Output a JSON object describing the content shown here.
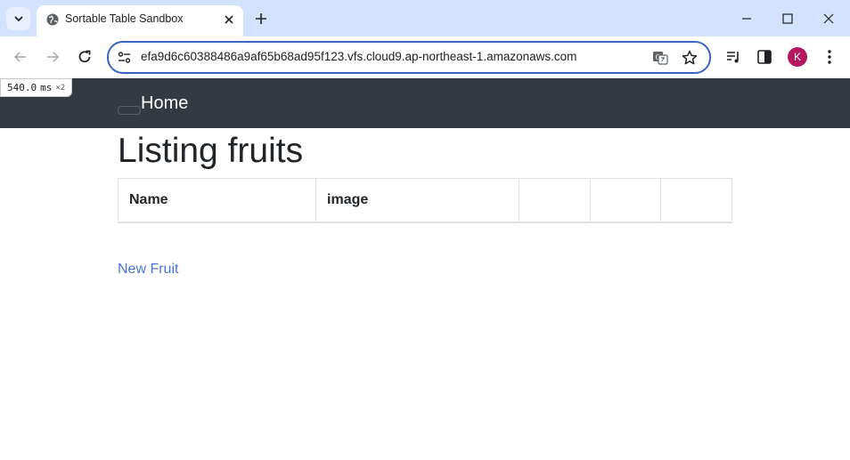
{
  "browser": {
    "tab": {
      "title": "Sortable Table Sandbox"
    },
    "address_bar": {
      "url": "efa9d6c60388486a9af65b68ad95f123.vfs.cloud9.ap-northeast-1.amazonaws.com"
    },
    "profile_initial": "K",
    "profile_color": "#b3185f",
    "accent_color": "#3b63c4",
    "perf_badge": {
      "value": "540.0",
      "unit": "ms",
      "multiplier": "×2"
    }
  },
  "navbar": {
    "brand": "Home"
  },
  "page": {
    "heading": "Listing fruits",
    "table": {
      "columns": [
        "Name",
        "image",
        "",
        "",
        ""
      ]
    },
    "new_link": "New Fruit"
  }
}
